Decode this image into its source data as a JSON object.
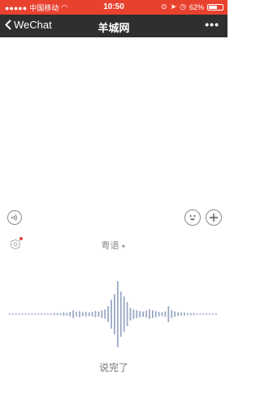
{
  "status_bar": {
    "carrier": "中国移动",
    "time": "10:50",
    "battery": "62%",
    "battery_level": 0.62
  },
  "nav": {
    "back_label": "WeChat",
    "title": "羊城网",
    "more_icon": "more-dots-icon"
  },
  "toolbar": {
    "left_icon": "voice-mode-icon",
    "emoji_icon": "emoji-icon",
    "plus_icon": "plus-icon"
  },
  "voice_panel": {
    "language": "粤语",
    "done_label": "说完了",
    "wave_color": "#9aa7c5",
    "wave_levels": [
      0.02,
      0.02,
      0.02,
      0.02,
      0.02,
      0.02,
      0.02,
      0.02,
      0.02,
      0.02,
      0.02,
      0.02,
      0.02,
      0.02,
      0.03,
      0.03,
      0.03,
      0.05,
      0.04,
      0.06,
      0.1,
      0.06,
      0.08,
      0.05,
      0.06,
      0.05,
      0.06,
      0.08,
      0.07,
      0.1,
      0.12,
      0.2,
      0.36,
      0.5,
      0.82,
      0.56,
      0.44,
      0.3,
      0.16,
      0.12,
      0.1,
      0.08,
      0.07,
      0.09,
      0.12,
      0.1,
      0.08,
      0.06,
      0.05,
      0.07,
      0.2,
      0.1,
      0.07,
      0.05,
      0.04,
      0.04,
      0.03,
      0.03,
      0.03,
      0.02,
      0.02,
      0.02,
      0.02,
      0.02,
      0.02,
      0.02
    ]
  }
}
